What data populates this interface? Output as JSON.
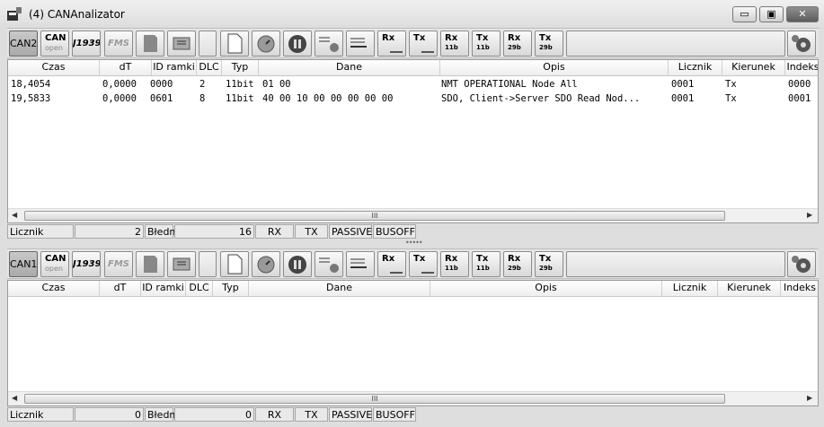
{
  "window": {
    "title": "(4) CANAnalizator",
    "minimize_label": "▭",
    "maximize_label": "▣",
    "close_label": "✕"
  },
  "toolbar_items": {
    "can_open_top": "CAN",
    "can_open_bottom": "open",
    "j1939": "J1939",
    "fms": "FMS",
    "rx": "Rx",
    "tx": "Tx",
    "rx11b": "11b",
    "tx11b": "11b",
    "rx29b": "29b",
    "tx29b": "29b"
  },
  "columns": {
    "czas": "Czas",
    "dt": "dT",
    "id": "ID ramki",
    "dlc": "DLC",
    "typ": "Typ",
    "dane": "Dane",
    "opis": "Opis",
    "licznik": "Licznik",
    "kierunek": "Kierunek",
    "indeks": "Indeks"
  },
  "panel_top": {
    "can_label": "CAN2",
    "rows": [
      {
        "czas": "18,4054",
        "dt": "0,0000",
        "id": "0000",
        "dlc": "2",
        "typ": "11bit",
        "dane": "01 00",
        "opis": "NMT OPERATIONAL Node All",
        "licznik": "0001",
        "kierunek": "Tx",
        "indeks": "0000"
      },
      {
        "czas": "19,5833",
        "dt": "0,0000",
        "id": "0601",
        "dlc": "8",
        "typ": "11bit",
        "dane": "40 00 10 00 00 00 00 00",
        "opis": "SDO, Client->Server SDO Read Nod...",
        "licznik": "0001",
        "kierunek": "Tx",
        "indeks": "0001"
      }
    ],
    "status": {
      "licznik_label": "Licznik",
      "licznik_value": "2",
      "bledne_label": "Błedne",
      "bledne_value": "16",
      "rx": "RX",
      "tx": "TX",
      "passive": "PASSIVE",
      "busoff": "BUSOFF"
    }
  },
  "panel_bottom": {
    "can_label": "CAN1",
    "rows": [],
    "status": {
      "licznik_label": "Licznik",
      "licznik_value": "0",
      "bledne_label": "Błedne",
      "bledne_value": "0",
      "rx": "RX",
      "tx": "TX",
      "passive": "PASSIVE",
      "busoff": "BUSOFF"
    }
  },
  "scrollbar_grip": "III",
  "splitter_grip": "•••••",
  "icons": [
    "app-icon",
    "sd-card-icon",
    "open-file-icon",
    "new-document-icon",
    "stopwatch-icon",
    "pause-icon",
    "filter-settings-icon",
    "filter-icon",
    "settings-gear-icon",
    "scroll-left-icon",
    "scroll-right-icon"
  ]
}
